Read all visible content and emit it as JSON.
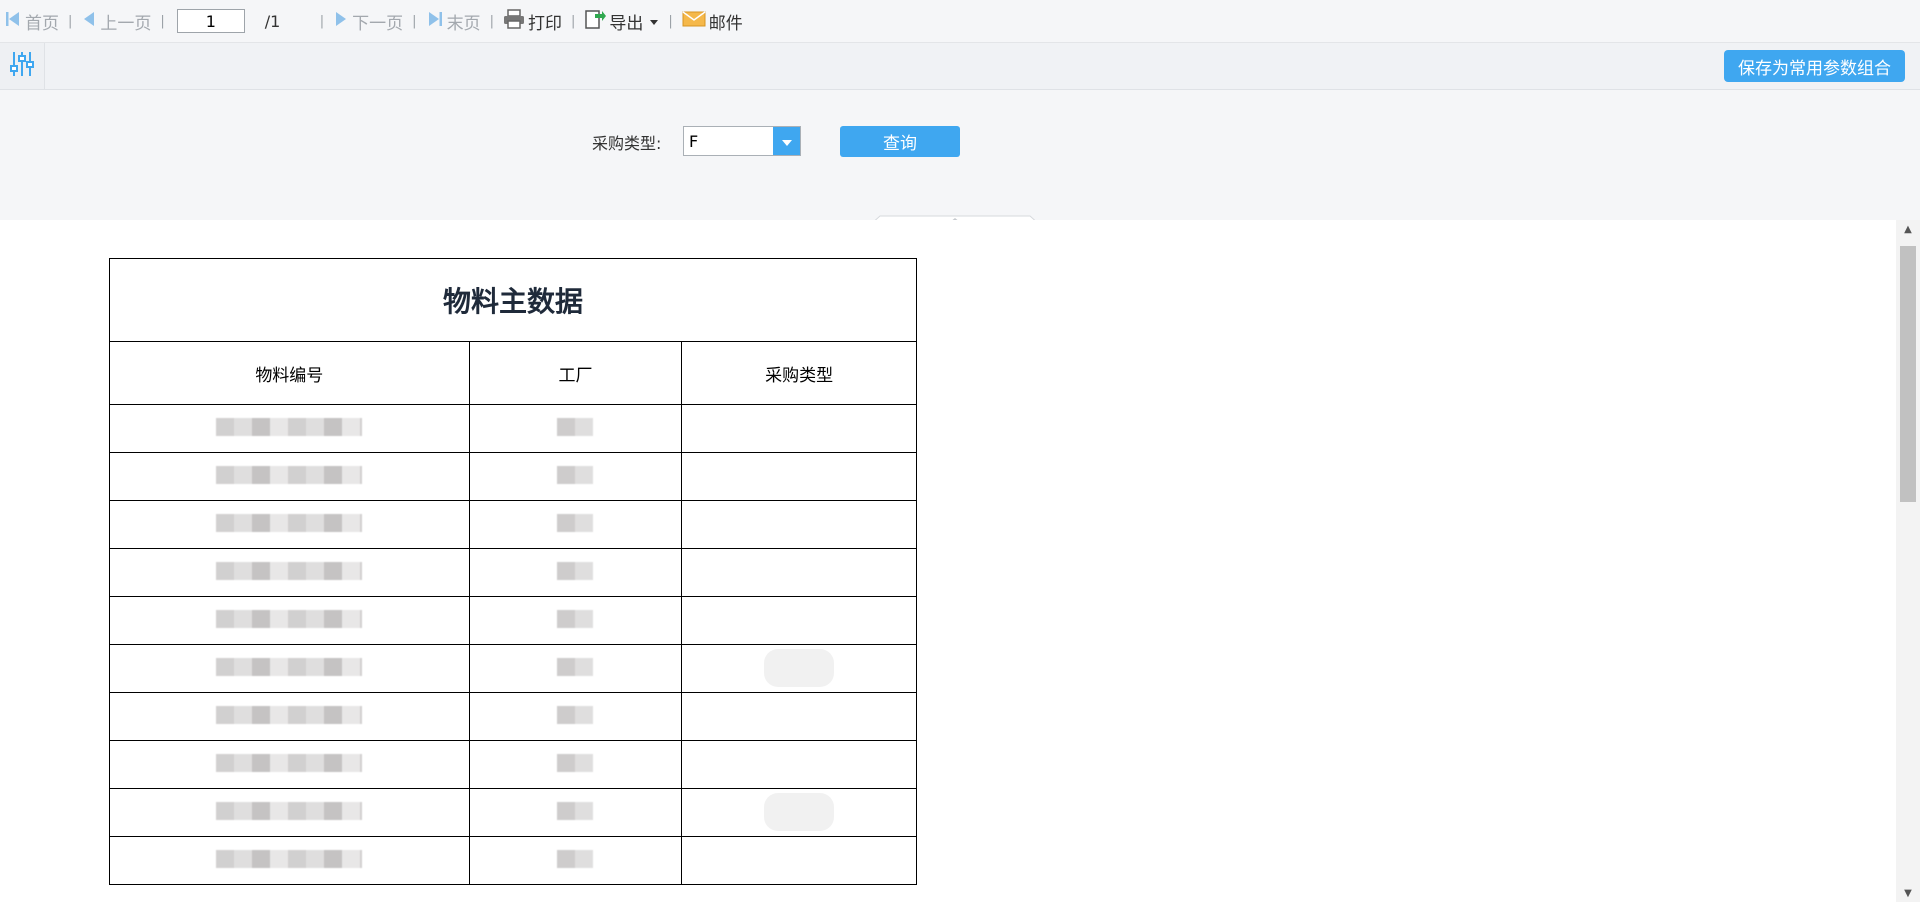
{
  "toolbar": {
    "first_label": "首页",
    "prev_label": "上一页",
    "page_value": "1",
    "page_total": "/1",
    "next_label": "下一页",
    "last_label": "末页",
    "print_label": "打印",
    "export_label": "导出",
    "mail_label": "邮件"
  },
  "param_bar": {
    "save_combo_label": "保存为常用参数组合"
  },
  "params": {
    "purchase_type_label": "采购类型:",
    "purchase_type_value": "F",
    "query_label": "查询"
  },
  "report": {
    "title": "物料主数据",
    "headers": [
      "物料编号",
      "工厂",
      "采购类型"
    ],
    "row_count_visible": 10
  },
  "colors": {
    "accent": "#3fa7f0",
    "toolbar_bg": "#f5f6f8",
    "disabled_text": "#a3a8ae"
  },
  "icons": {
    "first": "first-page-icon",
    "prev": "prev-page-icon",
    "next": "next-page-icon",
    "last": "last-page-icon",
    "print": "printer-icon",
    "export": "export-icon",
    "mail": "envelope-icon",
    "settings": "sliders-icon",
    "dropdown": "caret-down-icon"
  }
}
